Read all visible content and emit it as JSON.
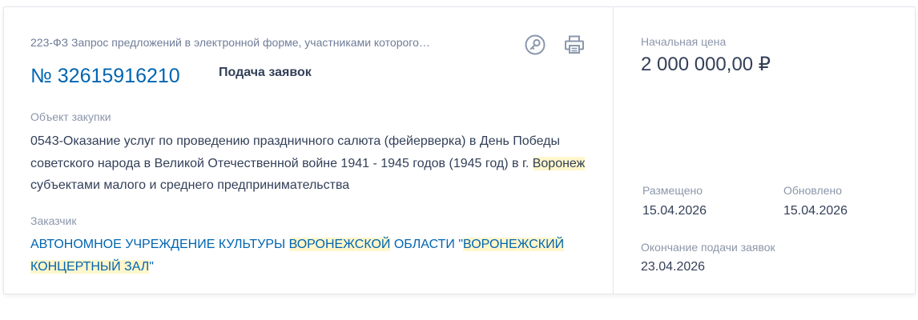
{
  "purchase": {
    "law_type": "223-ФЗ Запрос предложений в электронной форме, участниками которого…",
    "number": "№ 32615916210",
    "stage": "Подача заявок",
    "object_label": "Объект закупки",
    "object_text": {
      "before": "0543-Оказание услуг по проведению праздничного салюта (фейерверка) в День Победы советского народа в Великой Отечественной войне 1941 - 1945 годов (1945 год) в г. ",
      "highlight": "Воронеж",
      "after": " субъектами малого и среднего предпринимательства"
    },
    "customer_label": "Заказчик",
    "customer": {
      "part1": "АВТОНОМНОЕ УЧРЕЖДЕНИЕ КУЛЬТУРЫ ",
      "highlight1": "ВОРОНЕЖСКОЙ",
      "part2": " ОБЛАСТИ \"",
      "highlight2": "ВОРОНЕЖСКИЙ КОНЦЕРТНЫЙ ЗАЛ",
      "part3": "\""
    }
  },
  "info": {
    "price_label": "Начальная цена",
    "price": "2 000 000,00 ₽",
    "posted_label": "Размещено",
    "posted": "15.04.2026",
    "updated_label": "Обновлено",
    "updated": "15.04.2026",
    "end_label": "Окончание подачи заявок",
    "end": "23.04.2026"
  },
  "icons": {
    "key": "key-icon",
    "print": "printer-icon"
  },
  "colors": {
    "link": "#0065b1",
    "text": "#334059",
    "muted": "#8b96aa",
    "highlight": "#fff6cc",
    "icon": "#8a97ad"
  }
}
